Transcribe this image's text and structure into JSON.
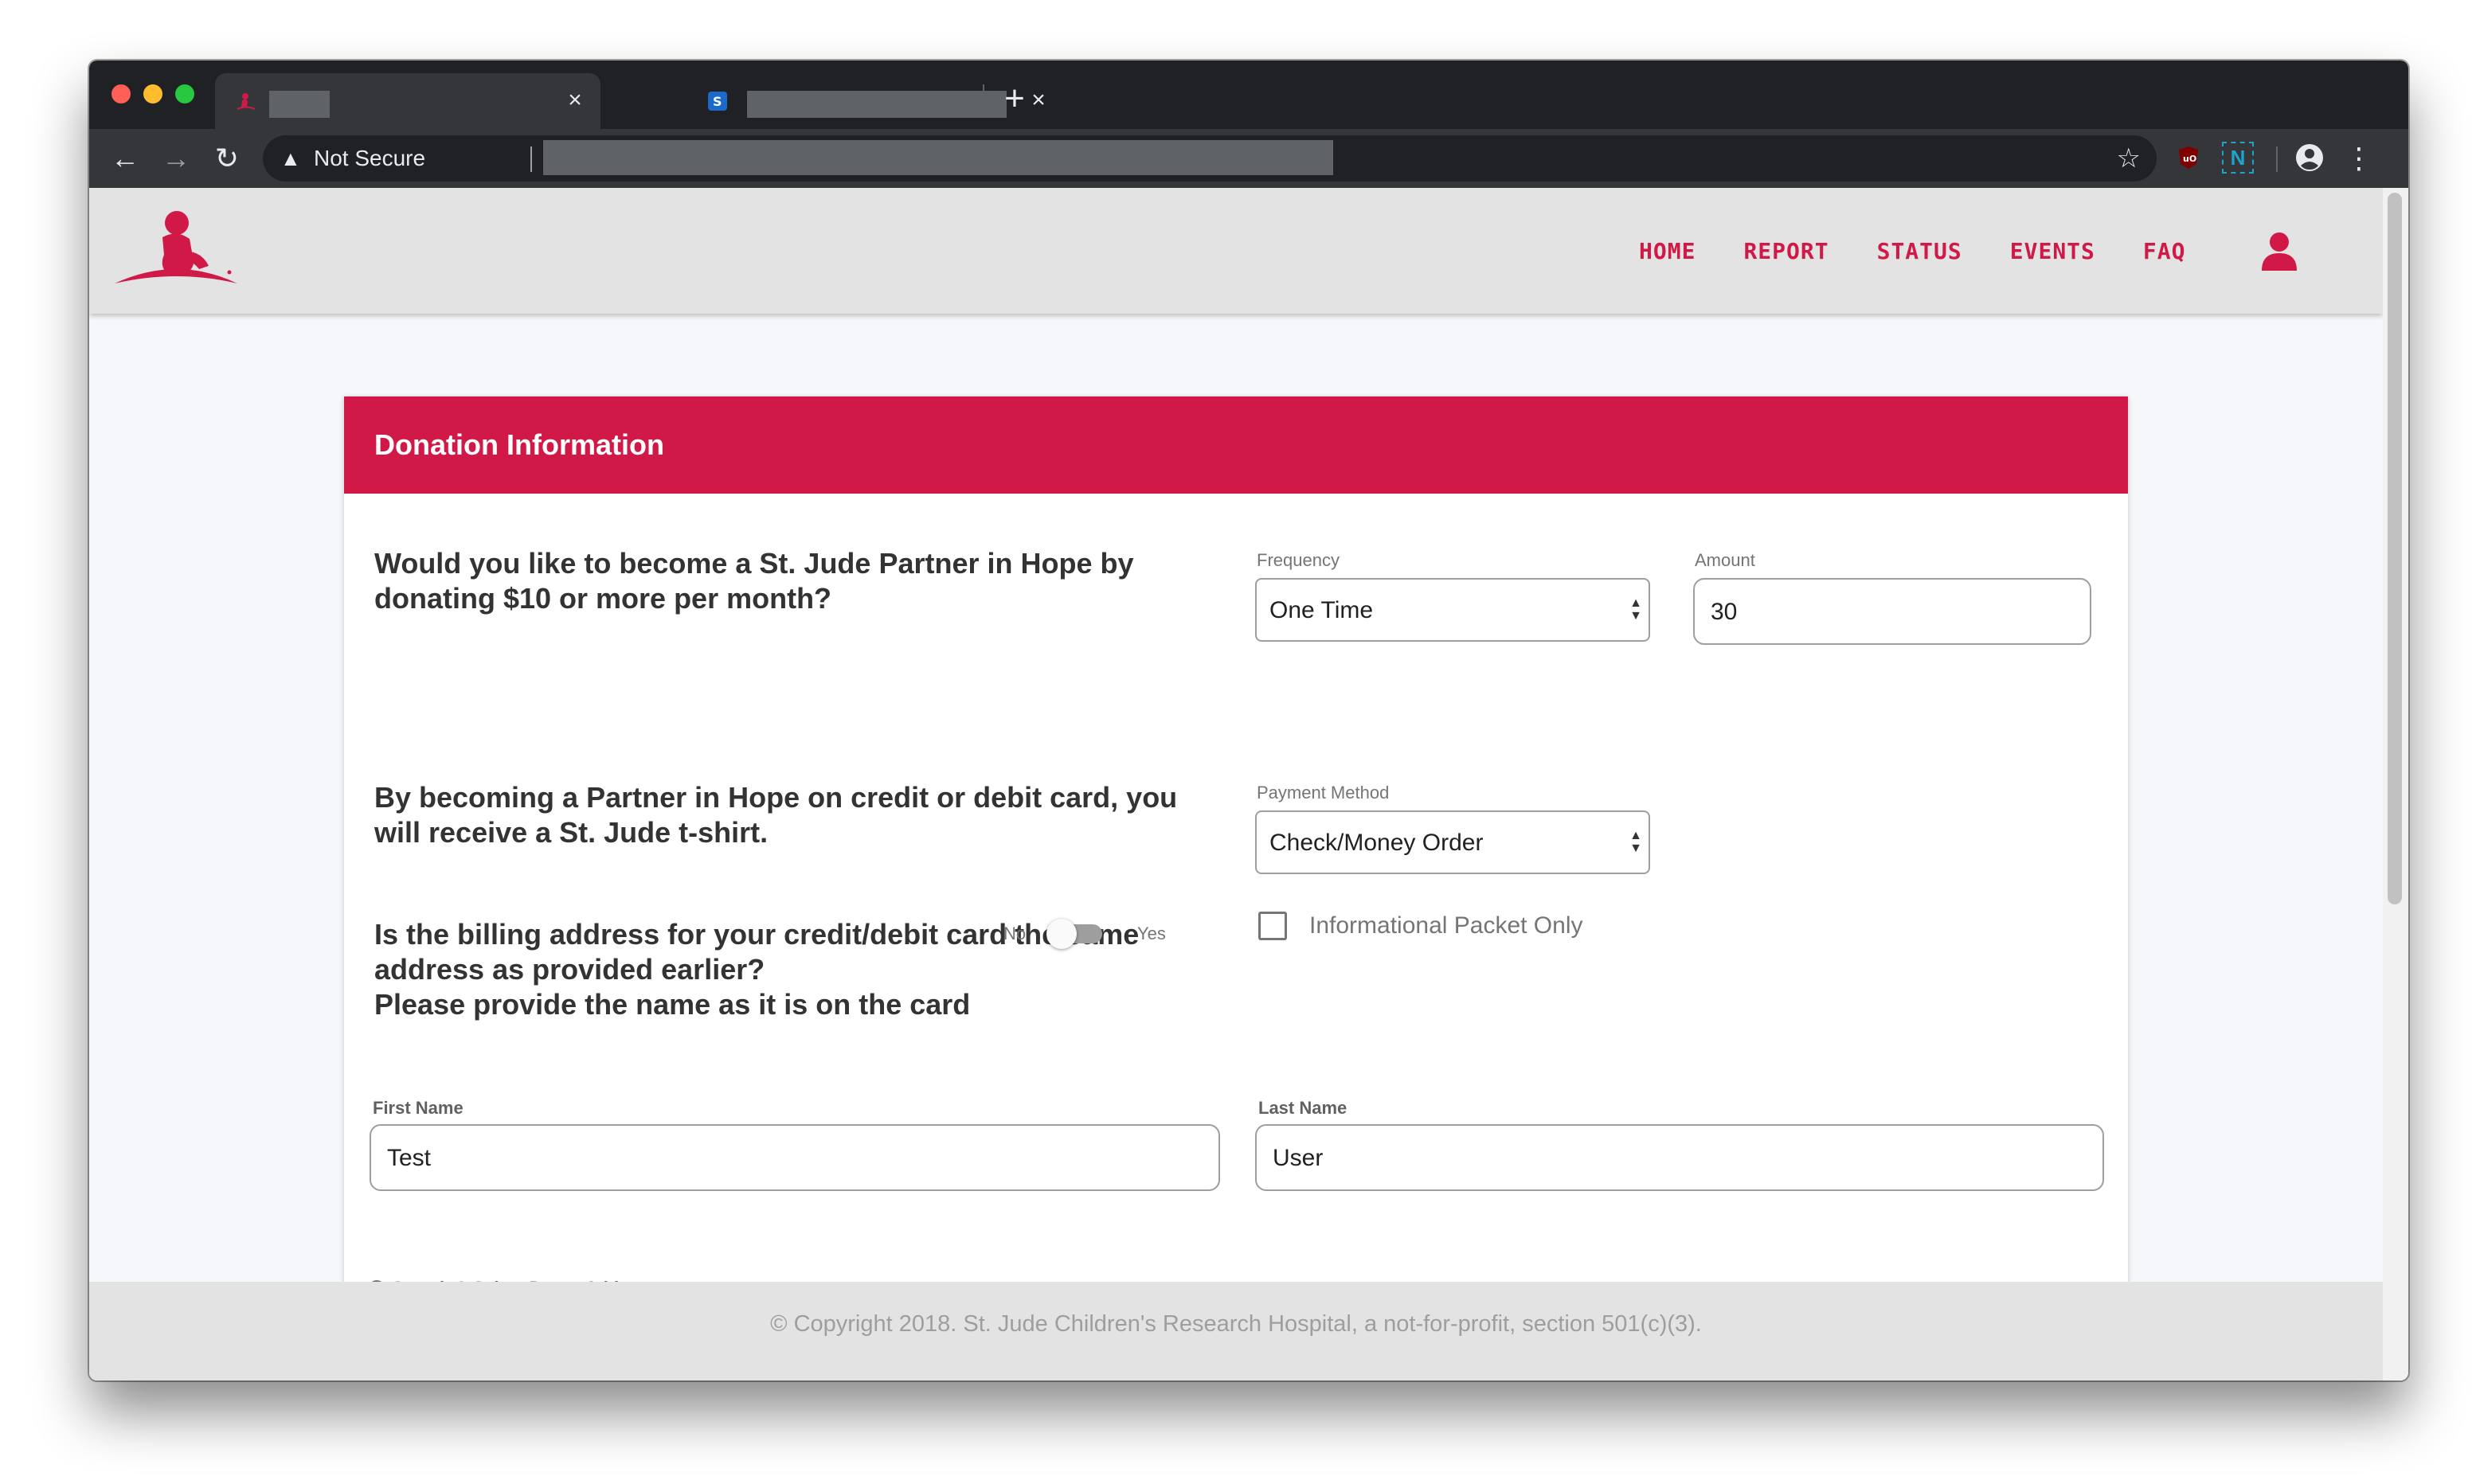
{
  "browser": {
    "security_label": "Not Secure",
    "tabs": [
      {
        "title": "",
        "favicon": "st-jude-favicon"
      },
      {
        "title": "",
        "favicon": "salesforce-favicon"
      }
    ]
  },
  "site": {
    "brand_color": "#d11947",
    "nav": [
      "HOME",
      "REPORT",
      "STATUS",
      "EVENTS",
      "FAQ"
    ]
  },
  "card": {
    "title": "Donation Information"
  },
  "questions": {
    "partner": "Would you like to become a St. Jude Partner in Hope by donating $10 or more per month?",
    "tshirt": "By becoming a Partner in Hope on credit or debit card, you will receive a St. Jude t-shirt.",
    "billing": "Is the billing address for your credit/debit card the same address as provided earlier?",
    "name_on_card": "Please provide the name as it is on the card"
  },
  "fields": {
    "frequency": {
      "label": "Frequency",
      "value": "One Time"
    },
    "amount": {
      "label": "Amount",
      "value": "30"
    },
    "info_packet": {
      "label": "Informational Packet Only",
      "checked": false
    },
    "payment_method": {
      "label": "Payment Method",
      "value": "Check/Money Order"
    },
    "billing_same": {
      "no_label": "No",
      "yes_label": "Yes",
      "value": false
    },
    "first_name": {
      "label": "First Name",
      "value": "Test"
    },
    "last_name": {
      "label": "Last Name",
      "value": "User"
    },
    "donor_address": {
      "label": "Search & Select Donor Address"
    }
  },
  "footer": {
    "text": "© Copyright 2018. St. Jude Children's Research Hospital, a not-for-profit, section 501(c)(3)."
  }
}
